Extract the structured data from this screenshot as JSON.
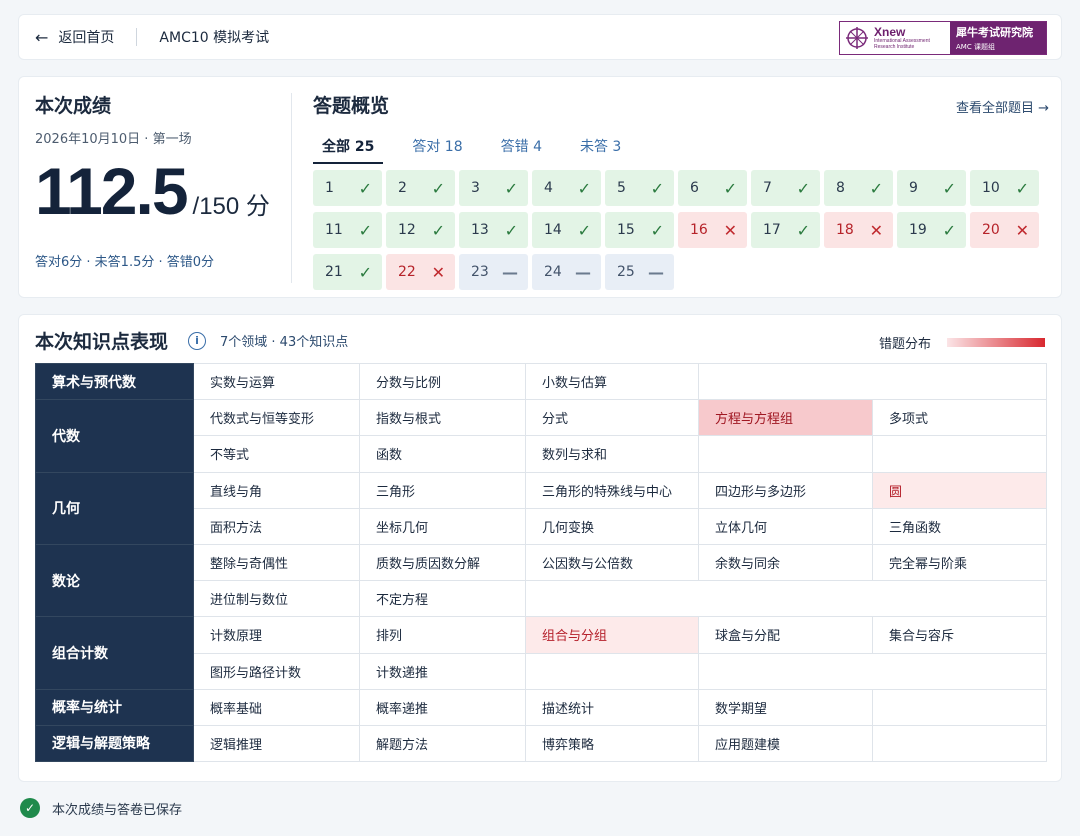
{
  "header": {
    "back_label": "返回首页",
    "title": "AMC10 模拟考试",
    "logo": {
      "brand": "Xnew",
      "sub1": "International Assessment",
      "sub2": "Research Institute",
      "cn_name": "犀牛考试研究院",
      "cn_sub": "AMC 课题组"
    }
  },
  "summary": {
    "title": "本次成绩",
    "date": "2026年10月10日 · 第一场",
    "score": "112.5",
    "max": "/150 分",
    "breakdown": "答对6分 · 未答1.5分 · 答错0分"
  },
  "answers": {
    "title": "答题概览",
    "view_all": "查看全部题目 →",
    "tabs": [
      "全部 25",
      "答对 18",
      "答错 4",
      "未答 3"
    ],
    "questions": [
      {
        "n": "1",
        "s": "correct"
      },
      {
        "n": "2",
        "s": "correct"
      },
      {
        "n": "3",
        "s": "correct"
      },
      {
        "n": "4",
        "s": "correct"
      },
      {
        "n": "5",
        "s": "correct"
      },
      {
        "n": "6",
        "s": "correct"
      },
      {
        "n": "7",
        "s": "correct"
      },
      {
        "n": "8",
        "s": "correct"
      },
      {
        "n": "9",
        "s": "correct"
      },
      {
        "n": "10",
        "s": "correct"
      },
      {
        "n": "11",
        "s": "correct"
      },
      {
        "n": "12",
        "s": "correct"
      },
      {
        "n": "13",
        "s": "correct"
      },
      {
        "n": "14",
        "s": "correct"
      },
      {
        "n": "15",
        "s": "correct"
      },
      {
        "n": "16",
        "s": "wrong"
      },
      {
        "n": "17",
        "s": "correct"
      },
      {
        "n": "18",
        "s": "wrong"
      },
      {
        "n": "19",
        "s": "correct"
      },
      {
        "n": "20",
        "s": "wrong"
      },
      {
        "n": "21",
        "s": "correct"
      },
      {
        "n": "22",
        "s": "wrong"
      },
      {
        "n": "23",
        "s": "blank"
      },
      {
        "n": "24",
        "s": "blank"
      },
      {
        "n": "25",
        "s": "blank"
      }
    ],
    "marks": {
      "correct": "✓",
      "wrong": "✕",
      "blank": "—"
    }
  },
  "knowledge": {
    "title": "本次知识点表现",
    "meta": "7个领域 · 43个知识点",
    "legend": "错题分布",
    "legend_colors": [
      "#fbe5e7",
      "#d8282f"
    ],
    "domains": [
      {
        "name": "算术与预代数",
        "rows": [
          [
            "实数与运算",
            "分数与比例",
            "小数与估算",
            "",
            ""
          ]
        ]
      },
      {
        "name": "代数",
        "rows": [
          [
            "代数式与恒等变形",
            "指数与根式",
            "分式",
            "方程与方程组",
            "多项式"
          ],
          [
            "不等式",
            "函数",
            "数列与求和",
            "",
            ""
          ]
        ]
      },
      {
        "name": "几何",
        "rows": [
          [
            "直线与角",
            "三角形",
            "三角形的特殊线与中心",
            "四边形与多边形",
            "圆"
          ],
          [
            "面积方法",
            "坐标几何",
            "几何变换",
            "立体几何",
            "三角函数"
          ]
        ]
      },
      {
        "name": "数论",
        "rows": [
          [
            "整除与奇偶性",
            "质数与质因数分解",
            "公因数与公倍数",
            "余数与同余",
            "完全幂与阶乘"
          ],
          [
            "进位制与数位",
            "不定方程",
            "",
            "",
            ""
          ]
        ]
      },
      {
        "name": "组合计数",
        "rows": [
          [
            "计数原理",
            "排列",
            "组合与分组",
            "球盒与分配",
            "集合与容斥"
          ],
          [
            "图形与路径计数",
            "计数递推",
            "",
            "",
            ""
          ]
        ]
      },
      {
        "name": "概率与统计",
        "rows": [
          [
            "概率基础",
            "概率递推",
            "描述统计",
            "数学期望",
            ""
          ]
        ]
      },
      {
        "name": "逻辑与解题策略",
        "rows": [
          [
            "逻辑推理",
            "解题方法",
            "博弈策略",
            "应用题建模",
            ""
          ]
        ]
      }
    ],
    "highlights": {
      "方程与方程组": 2,
      "圆": 1,
      "组合与分组": 1
    }
  },
  "footer": {
    "status": "本次成绩与答卷已保存",
    "icon": "check-circle-icon"
  }
}
